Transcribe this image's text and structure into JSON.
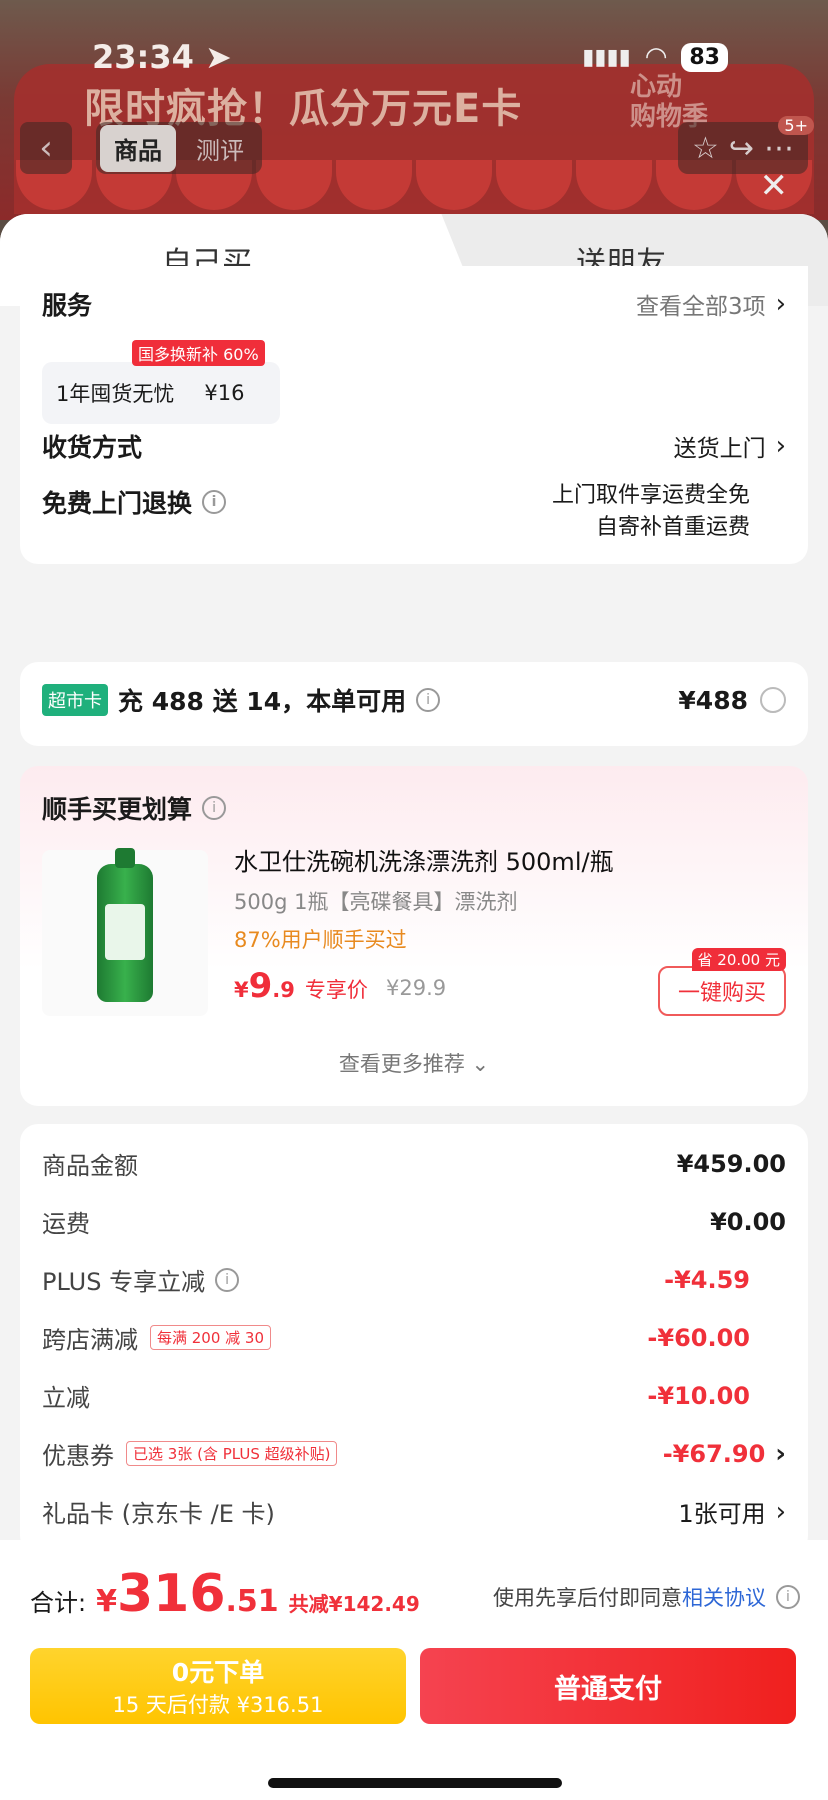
{
  "status_bar": {
    "time": "23:34",
    "battery": "83"
  },
  "banner": {
    "text": "限时疯抢！瓜分万元E卡",
    "logo_line1": "心动",
    "logo_line2": "购物季"
  },
  "nav": {
    "tabs": [
      "商品",
      "测评"
    ],
    "badge": "5+"
  },
  "sheet": {
    "tabs": [
      "自己买",
      "送朋友"
    ],
    "service": {
      "title": "服务",
      "view_all": "查看全部3项",
      "chip_tag": "国多换新补 60%",
      "chip_name": "1年囤货无忧",
      "chip_price": "¥16"
    },
    "delivery": {
      "label": "收货方式",
      "value": "送货上门"
    },
    "return": {
      "label": "免费上门退换",
      "line1": "上门取件享运费全免",
      "line2": "自寄补首重运费"
    },
    "supermarket": {
      "tag": "超市卡",
      "text": "充 488 送 14，本单可用",
      "amount": "¥488"
    },
    "recommend": {
      "title": "顺手买更划算",
      "product_title": "水卫仕洗碗机洗涤漂洗剂 500ml/瓶",
      "spec": "500g 1瓶【亮碟餐具】漂洗剂",
      "bought": "87%用户顺手买过",
      "price_cur": "¥",
      "price_int": "9",
      "price_dec": ".9",
      "price_label": "专享价",
      "old_price": "¥29.9",
      "save_tag": "省 20.00 元",
      "buy_label": "一键购买",
      "more": "查看更多推荐"
    },
    "summary": {
      "rows": [
        {
          "label": "商品金额",
          "value": "¥459.00"
        },
        {
          "label": "运费",
          "value": "¥0.00"
        },
        {
          "label": "PLUS 专享立减",
          "value": "-¥4.59"
        },
        {
          "label": "跨店满减",
          "pill": "每满 200 减 30",
          "value": "-¥60.00"
        },
        {
          "label": "立减",
          "value": "-¥10.00"
        },
        {
          "label": "优惠券",
          "pill": "已选 3张 (含 PLUS 超级补贴)",
          "value": "-¥67.90"
        },
        {
          "label": "礼品卡 (京东卡 /E 卡)",
          "value": "1张可用"
        }
      ]
    }
  },
  "footer": {
    "total_label": "合计:",
    "cur": "¥",
    "int": "316",
    "dec": ".51",
    "discount": "共减¥142.49",
    "agree_text": "使用先享后付即同意",
    "agree_link": "相关协议",
    "later_t1": "0元下单",
    "later_t2": "15 天后付款 ¥316.51",
    "pay": "普通支付"
  },
  "colors": {
    "accent_red": "#f0303a",
    "yellow": "#ffc400",
    "green_tag": "#1fb07c",
    "link_blue": "#2e67d6"
  }
}
